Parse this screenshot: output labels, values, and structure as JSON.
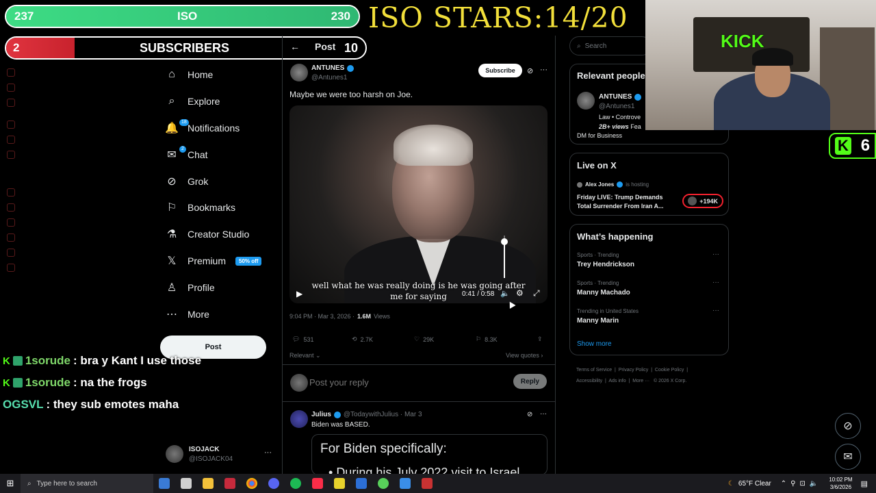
{
  "overlay": {
    "iso_left": "237",
    "iso_label": "ISO",
    "iso_right": "230",
    "subs_count": "2",
    "subs_label": "SUBSCRIBERS",
    "stars": "ISO STARS:14/20",
    "kick_count": "6",
    "kick_logo": "K"
  },
  "header": {
    "back": "←",
    "title": "Post",
    "count": "10"
  },
  "nav": {
    "items": [
      {
        "label": "Home",
        "icon": "home-icon",
        "glyph": "⌂"
      },
      {
        "label": "Explore",
        "icon": "search-icon",
        "glyph": "⌕"
      },
      {
        "label": "Notifications",
        "icon": "bell-icon",
        "glyph": "🔔",
        "badge": "18"
      },
      {
        "label": "Chat",
        "icon": "mail-icon",
        "glyph": "✉",
        "badge": "2"
      },
      {
        "label": "Grok",
        "icon": "grok-icon",
        "glyph": "⊘"
      },
      {
        "label": "Bookmarks",
        "icon": "bookmark-icon",
        "glyph": "⚐"
      },
      {
        "label": "Creator Studio",
        "icon": "flask-icon",
        "glyph": "⚗"
      },
      {
        "label": "Premium",
        "icon": "x-logo-icon",
        "glyph": "𝕏",
        "tag": "50% off"
      },
      {
        "label": "Profile",
        "icon": "person-icon",
        "glyph": "♙"
      },
      {
        "label": "More",
        "icon": "more-circle-icon",
        "glyph": "⋯"
      }
    ],
    "post_button": "Post"
  },
  "account": {
    "name": "ISOJACK",
    "handle": "@ISOJACK04",
    "menu": "···"
  },
  "chat": [
    {
      "user": "1sorude",
      "msg": ": bra y Kant I use those",
      "color": "#7fd86a"
    },
    {
      "user": "1sorude",
      "msg": ": na the frogs",
      "color": "#7fd86a"
    },
    {
      "user": "OGSVL",
      "msg": ": they sub emotes maha",
      "color": "#58e0b0"
    }
  ],
  "post": {
    "author": "ANTUNES",
    "handle": "@Antunes1",
    "subscribe": "Subscribe",
    "text": "Maybe we were too harsh on Joe.",
    "caption_1": "well what he was really doing is he was going after",
    "caption_2": "me for saying",
    "time_display": "0:41 / 0:58",
    "volume_level": 0.85,
    "timestamp": "9:04 PM · Mar 3, 2026 ·",
    "views": "1.6M",
    "views_label": "Views",
    "replies": "531",
    "reposts": "2.7K",
    "likes": "29K",
    "bookmarks": "8.3K",
    "sort": "Relevant",
    "view_quotes": "View quotes",
    "reply_placeholder": "Post your reply",
    "reply_button": "Reply"
  },
  "reply": {
    "author": "Julius",
    "handle": "@TodaywithJulius · Mar 3",
    "text": "Biden was BASED.",
    "embed_title": "For Biden specifically:",
    "embed_bullet": "During his July 2022 visit to Israel"
  },
  "search": {
    "placeholder": "Search"
  },
  "relevant": {
    "title": "Relevant people",
    "name": "ANTUNES",
    "handle": "@Antunes1",
    "bio_1": "Law • Controve",
    "bio_2_bold": "2B+ views",
    "bio_2": " Fea",
    "bio_3": "DM for Business"
  },
  "live": {
    "title": "Live on X",
    "host": "Alex Jones",
    "hosting": "is hosting",
    "headline": "Friday LIVE: Trump Demands Total Surrender From Iran A...",
    "listeners": "+194K"
  },
  "happening": {
    "title": "What’s happening",
    "items": [
      {
        "context": "Sports · Trending",
        "topic": "Trey Hendrickson"
      },
      {
        "context": "Sports · Trending",
        "topic": "Manny Machado"
      },
      {
        "context": "Trending in United States",
        "topic": "Manny Marin"
      }
    ],
    "show_more": "Show more"
  },
  "footer": {
    "links": [
      "Terms of Service",
      "Privacy Policy",
      "Cookie Policy",
      "Accessibility",
      "Ads info",
      "More ···"
    ],
    "copyright": "© 2026 X Corp."
  },
  "taskbar": {
    "search_placeholder": "Type here to search",
    "weather": "65°F  Clear",
    "time": "10:02 PM",
    "date": "3/6/2026"
  }
}
